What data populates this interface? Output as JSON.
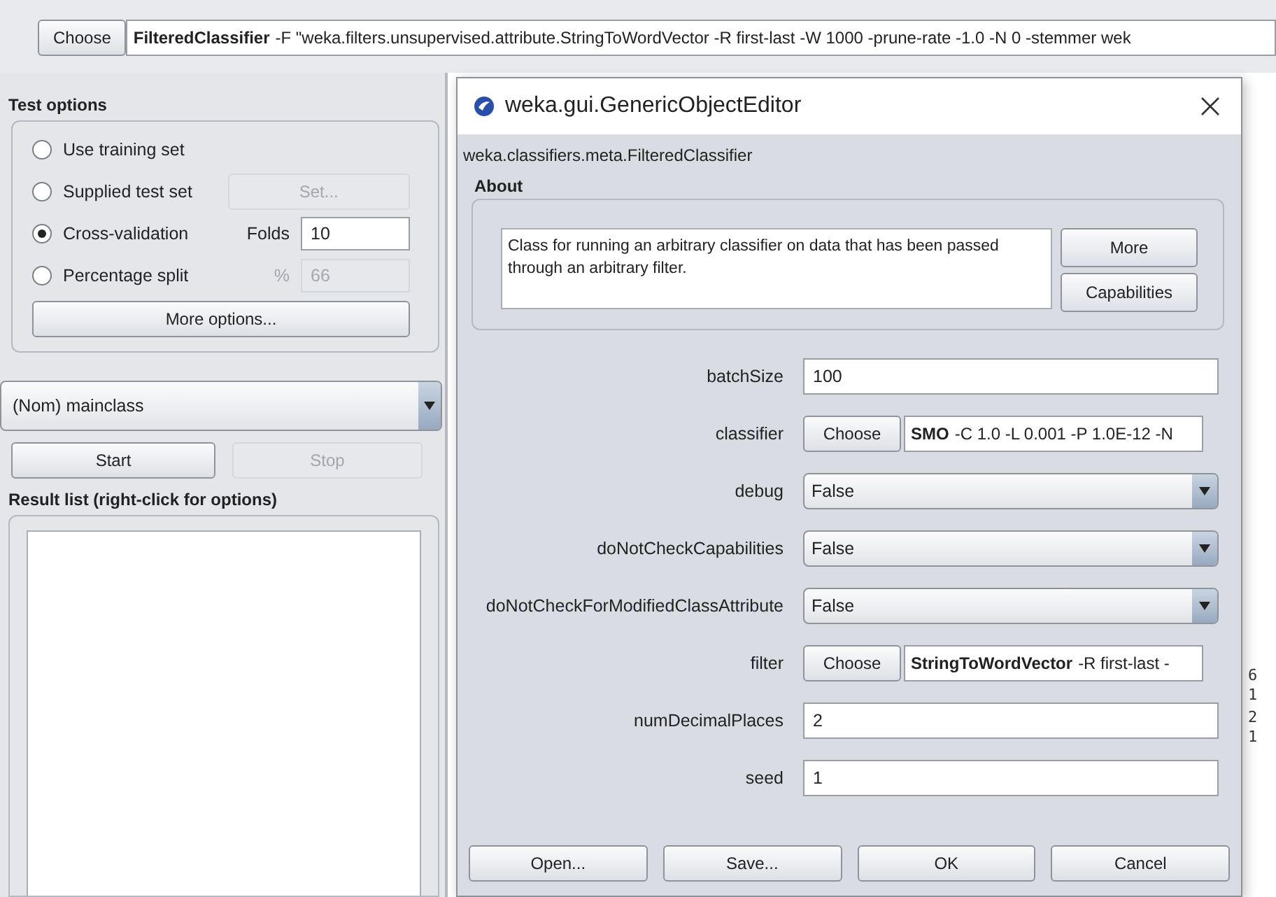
{
  "classifier_bar": {
    "button": "Choose",
    "name": "FilteredClassifier",
    "options": "-F \"weka.filters.unsupervised.attribute.StringToWordVector -R first-last -W 1000 -prune-rate -1.0 -N 0 -stemmer wek"
  },
  "test_options": {
    "title": "Test options",
    "options": [
      {
        "label": "Use training set",
        "selected": false,
        "kind": "plain"
      },
      {
        "label": "Supplied test set",
        "selected": false,
        "kind": "button",
        "button": "Set...",
        "disabled": true
      },
      {
        "label": "Cross-validation",
        "selected": true,
        "kind": "field",
        "field_label": "Folds",
        "value": "10",
        "disabled": false
      },
      {
        "label": "Percentage split",
        "selected": false,
        "kind": "field",
        "field_label": "%",
        "value": "66",
        "disabled": true
      }
    ],
    "more": "More options..."
  },
  "class_select": "(Nom) mainclass",
  "run_buttons": [
    {
      "label": "Start",
      "disabled": false
    },
    {
      "label": "Stop",
      "disabled": true
    }
  ],
  "result_list": {
    "title": "Result list (right-click for options)"
  },
  "output_fragments": [
    "6",
    "1",
    "2",
    "1"
  ],
  "dialog": {
    "title": "weka.gui.GenericObjectEditor",
    "class_name": "weka.classifiers.meta.FilteredClassifier",
    "about": {
      "title": "About",
      "text": "Class for running an arbitrary classifier on data that has been passed through an arbitrary filter.",
      "buttons": [
        "More",
        "Capabilities"
      ]
    },
    "properties": [
      {
        "label": "batchSize",
        "kind": "text",
        "value": "100"
      },
      {
        "label": "classifier",
        "kind": "object",
        "button": "Choose",
        "name": "SMO",
        "options": "-C 1.0 -L 0.001 -P 1.0E-12 -N"
      },
      {
        "label": "debug",
        "kind": "select",
        "value": "False"
      },
      {
        "label": "doNotCheckCapabilities",
        "kind": "select",
        "value": "False"
      },
      {
        "label": "doNotCheckForModifiedClassAttribute",
        "kind": "select",
        "value": "False"
      },
      {
        "label": "filter",
        "kind": "object",
        "button": "Choose",
        "name": "StringToWordVector",
        "options": "-R first-last -"
      },
      {
        "label": "numDecimalPlaces",
        "kind": "text",
        "value": "2"
      },
      {
        "label": "seed",
        "kind": "text",
        "value": "1"
      }
    ],
    "buttons": [
      "Open...",
      "Save...",
      "OK",
      "Cancel"
    ]
  }
}
